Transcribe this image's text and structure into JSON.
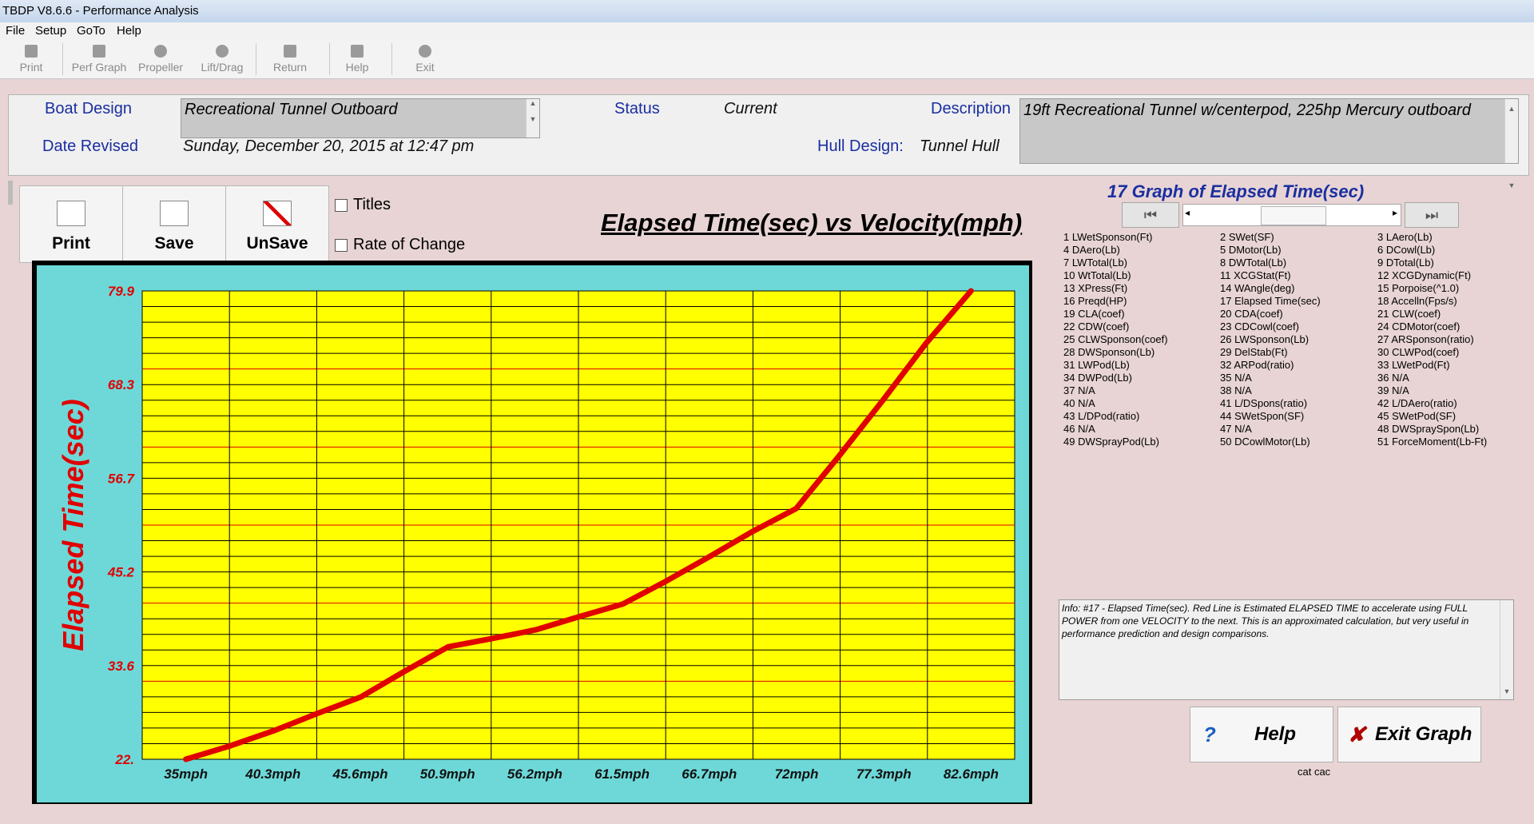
{
  "window": {
    "title": "TBDP V8.6.6 - Performance Analysis"
  },
  "menu": [
    "File",
    "Setup",
    "GoTo",
    "Help"
  ],
  "toolbar": [
    {
      "label": "Print",
      "icon": "printer-icon"
    },
    {
      "label": "Perf Graph",
      "icon": "graph-icon"
    },
    {
      "label": "Propeller",
      "icon": "propeller-icon"
    },
    {
      "label": "Lift/Drag",
      "icon": "liftdrag-icon"
    },
    {
      "label": "Return",
      "icon": "return-icon"
    },
    {
      "label": "Help",
      "icon": "help-icon"
    },
    {
      "label": "Exit",
      "icon": "exit-icon"
    }
  ],
  "header": {
    "boat_design_label": "Boat Design",
    "boat_design_value": "Recreational Tunnel Outboard",
    "date_revised_label": "Date Revised",
    "date_revised_value": "Sunday, December 20, 2015 at 12:47 pm",
    "status_label": "Status",
    "status_value": "Current",
    "hull_design_label": "Hull Design:",
    "hull_design_value": "Tunnel Hull",
    "description_label": "Description",
    "description_value": "19ft Recreational Tunnel w/centerpod, 225hp Mercury outboard"
  },
  "graph_buttons": [
    {
      "label": "Print",
      "icon": "print-icon"
    },
    {
      "label": "Save",
      "icon": "save-graph-icon"
    },
    {
      "label": "UnSave",
      "icon": "unsave-graph-icon"
    }
  ],
  "options": {
    "titles": "Titles",
    "rate_of_change": "Rate of Change"
  },
  "chart_title": "Elapsed Time(sec) vs Velocity(mph)",
  "chart_data": {
    "type": "line",
    "title": "Elapsed Time(sec) vs Velocity(mph)",
    "xlabel": "",
    "ylabel": "Elapsed Time(sec)",
    "categories": [
      "35mph",
      "40.3mph",
      "45.6mph",
      "50.9mph",
      "56.2mph",
      "61.5mph",
      "66.7mph",
      "72mph",
      "77.3mph",
      "82.6mph"
    ],
    "y_tick_labels": [
      "79.9",
      "68.3",
      "56.7",
      "45.2",
      "33.6",
      "22."
    ],
    "ylim": [
      22.0,
      79.9
    ],
    "grid": true,
    "series": [
      {
        "color": "#e00000",
        "x": [
          35,
          37.6,
          40.3,
          42.9,
          45.6,
          48.2,
          50.9,
          53.5,
          56.2,
          58.8,
          61.5,
          64.1,
          66.7,
          69.3,
          72,
          74.6,
          77.3,
          79.9,
          82.6
        ],
        "values": [
          22.0,
          23.6,
          25.5,
          27.6,
          29.7,
          32.8,
          35.9,
          36.9,
          38.0,
          39.6,
          41.2,
          44.0,
          47.0,
          50.1,
          53.0,
          59.5,
          66.5,
          73.5,
          79.9
        ]
      }
    ],
    "colors": {
      "plot_bg": "#ffff00",
      "outer_bg": "#6ed8d8",
      "line": "#e00000",
      "grid_major": "#000000",
      "grid_minor": "#e00000"
    }
  },
  "right_panel": {
    "heading": "17 Graph of Elapsed Time(sec)",
    "columns": [
      [
        "1 LWetSponson(Ft)",
        "4 DAero(Lb)",
        "7 LWTotal(Lb)",
        "10 WtTotal(Lb)",
        "13 XPress(Ft)",
        "16 Preqd(HP)",
        "19 CLA(coef)",
        "22 CDW(coef)",
        "25 CLWSponson(coef)",
        "28 DWSponson(Lb)",
        "31 LWPod(Lb)",
        "34 DWPod(Lb)",
        "37 N/A",
        "40 N/A",
        "43 L/DPod(ratio)",
        "46 N/A",
        "49 DWSprayPod(Lb)"
      ],
      [
        "2 SWet(SF)",
        "5 DMotor(Lb)",
        "8 DWTotal(Lb)",
        "11 XCGStat(Ft)",
        "14 WAngle(deg)",
        "17 Elapsed Time(sec)",
        "20 CDA(coef)",
        "23 CDCowl(coef)",
        "26 LWSponson(Lb)",
        "29 DelStab(Ft)",
        "32 ARPod(ratio)",
        "35 N/A",
        "38 N/A",
        "41 L/DSpons(ratio)",
        "44 SWetSpon(SF)",
        "47 N/A",
        "50 DCowlMotor(Lb)"
      ],
      [
        "3 LAero(Lb)",
        "6 DCowl(Lb)",
        "9 DTotal(Lb)",
        "12 XCGDynamic(Ft)",
        "15 Porpoise(^1.0)",
        "18 Accelln(Fps/s)",
        "21 CLW(coef)",
        "24 CDMotor(coef)",
        "27 ARSponson(ratio)",
        "30 CLWPod(coef)",
        "33 LWetPod(Ft)",
        "36 N/A",
        "39 N/A",
        "42 L/DAero(ratio)",
        "45 SWetPod(SF)",
        "48 DWSpraySpon(Lb)",
        "51 ForceMoment(Lb-Ft)"
      ]
    ],
    "info": "Info: #17 - Elapsed Time(sec). Red Line is Estimated ELAPSED TIME to accelerate using FULL POWER from one VELOCITY to the next.  This is an approximated calculation, but very useful in performance prediction and design comparisons.",
    "help_label": "Help",
    "exit_label": "Exit Graph",
    "footnote": "cat cac"
  }
}
